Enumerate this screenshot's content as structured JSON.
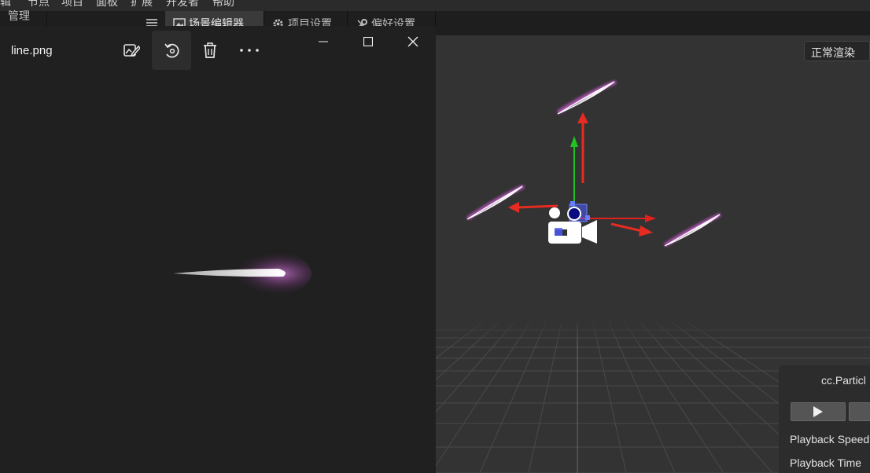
{
  "menubar": {
    "items": [
      "辑",
      "节点",
      "项目",
      "面板",
      "扩展",
      "开发者",
      "帮助"
    ]
  },
  "panels": {
    "left_panel_label": "管理器"
  },
  "tabs": [
    {
      "label": "场景编辑器",
      "icon": "scene-icon",
      "active": true
    },
    {
      "label": "项目设置",
      "icon": "gear-icon",
      "active": false
    },
    {
      "label": "偏好设置",
      "icon": "wrench-icon",
      "active": false
    }
  ],
  "scene": {
    "render_mode": "正常渲染"
  },
  "particle_panel": {
    "title": "cc.Particl",
    "speed_label": "Playback Speed",
    "time_label": "Playback Time"
  },
  "viewer": {
    "file_name": "line.png",
    "toolbar": [
      "edit-image-icon",
      "rotate-icon",
      "delete-icon",
      "more-icon"
    ],
    "window_buttons": [
      "minimize-icon",
      "maximize-icon",
      "close-icon"
    ]
  },
  "colors": {
    "scene_bg": "#333333",
    "viewer_bg": "#202020",
    "gizmo_y": "#22c322",
    "gizmo_x": "#e0201c",
    "particle_glow": "#e060e8"
  }
}
